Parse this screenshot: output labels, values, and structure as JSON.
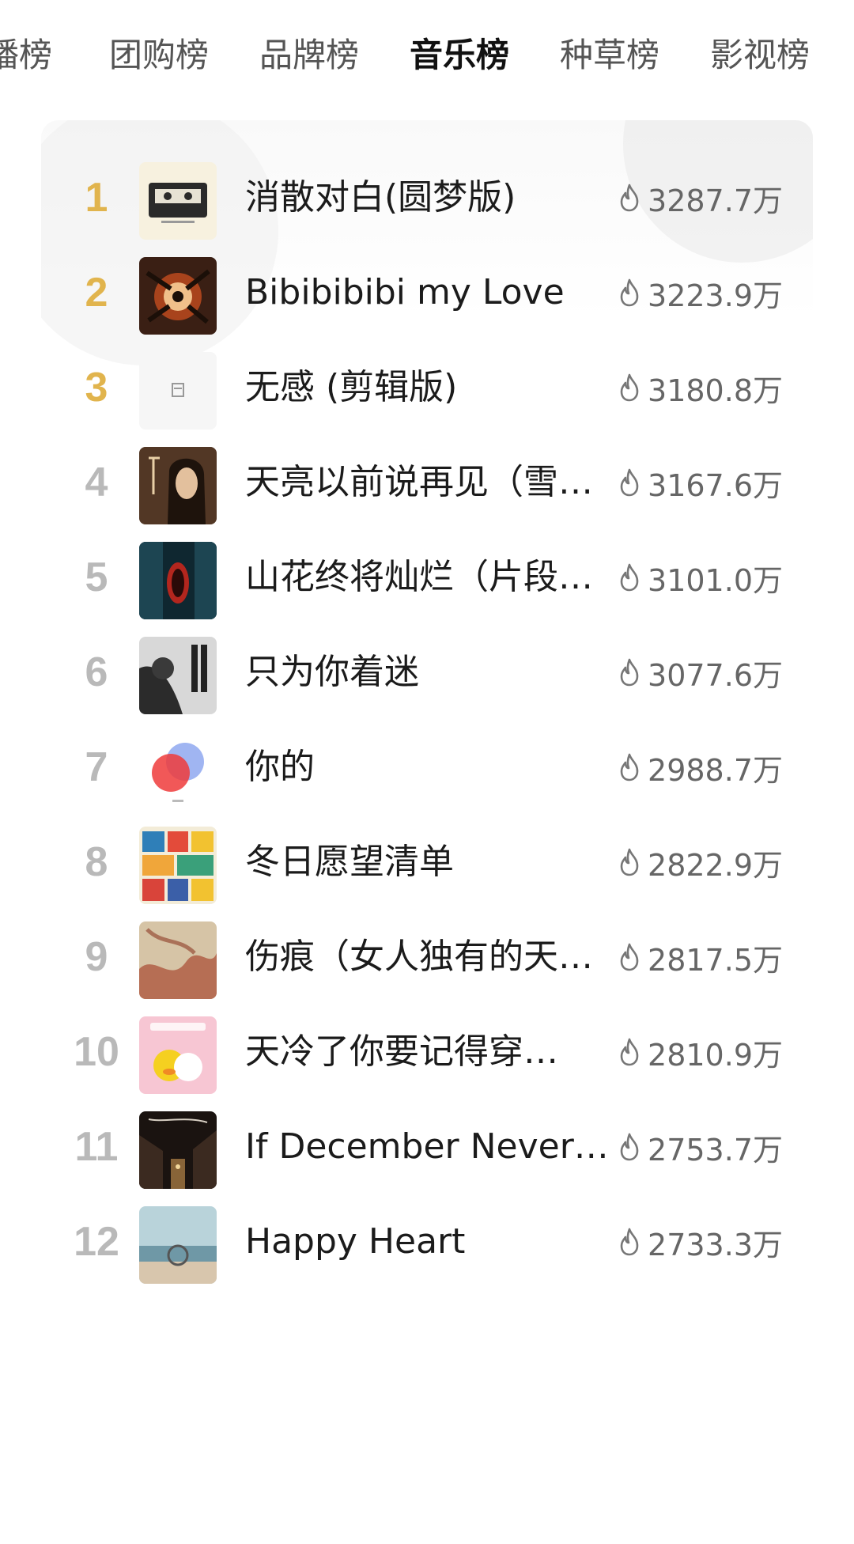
{
  "tabs": [
    {
      "label": "播榜",
      "active": false
    },
    {
      "label": "团购榜",
      "active": false
    },
    {
      "label": "品牌榜",
      "active": false
    },
    {
      "label": "音乐榜",
      "active": true
    },
    {
      "label": "种草榜",
      "active": false
    },
    {
      "label": "影视榜",
      "active": false
    }
  ],
  "colors": {
    "gold_rank": "#e1b44d",
    "gray_rank": "#b9b9b9",
    "heat_text": "#666666"
  },
  "icons": {
    "heat": "fire-icon"
  },
  "songs": [
    {
      "rank": "1",
      "title": "消散对白(圆梦版)",
      "heat": "3287.7万"
    },
    {
      "rank": "2",
      "title": "Bibibibibi my Love",
      "heat": "3223.9万"
    },
    {
      "rank": "3",
      "title": "无感 (剪辑版)",
      "heat": "3180.8万"
    },
    {
      "rank": "4",
      "title": "天亮以前说再见（雪…",
      "heat": "3167.6万"
    },
    {
      "rank": "5",
      "title": "山花终将灿烂（片段…",
      "heat": "3101.0万"
    },
    {
      "rank": "6",
      "title": "只为你着迷",
      "heat": "3077.6万"
    },
    {
      "rank": "7",
      "title": "你的",
      "heat": "2988.7万"
    },
    {
      "rank": "8",
      "title": "冬日愿望清单",
      "heat": "2822.9万"
    },
    {
      "rank": "9",
      "title": "伤痕（女人独有的天…",
      "heat": "2817.5万"
    },
    {
      "rank": "10",
      "title": "天冷了你要记得穿…",
      "heat": "2810.9万"
    },
    {
      "rank": "11",
      "title": "If December Never…",
      "heat": "2753.7万"
    },
    {
      "rank": "12",
      "title": "Happy Heart",
      "heat": "2733.3万"
    }
  ]
}
